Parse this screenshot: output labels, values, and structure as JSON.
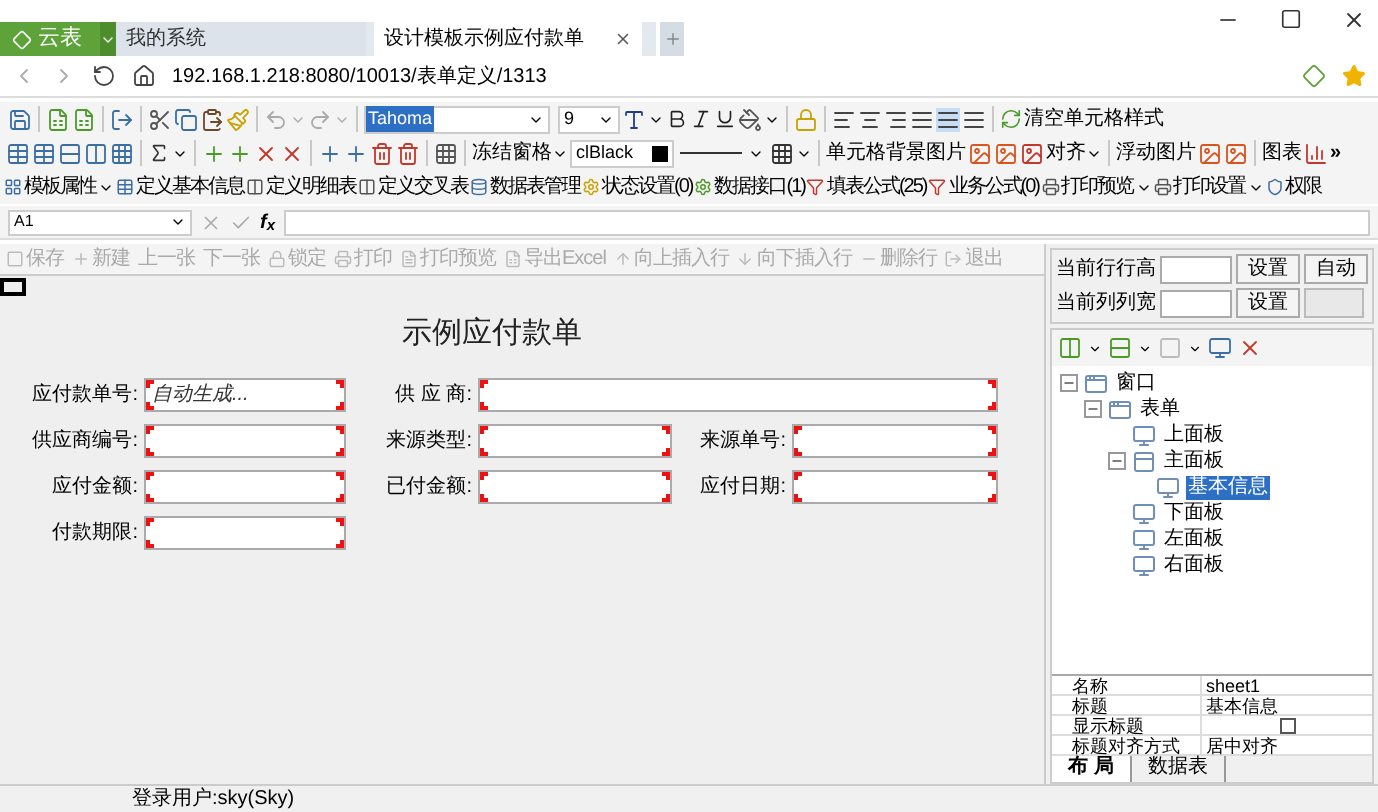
{
  "browser": {
    "brand": "云表",
    "tabs": [
      {
        "label": "我的系统",
        "selected": false
      },
      {
        "label": "设计模板示例应付款单",
        "selected": true
      }
    ],
    "address": "192.168.1.218:8080/10013/表单定义/1313"
  },
  "toolbar_1": {
    "font": "Tahoma",
    "size": "9",
    "clear_style": "清空单元格样式"
  },
  "toolbar_2": {
    "freeze": "冻结窗格",
    "color_name": "clBlack",
    "cell_background": "单元格背景图片",
    "align": "对齐",
    "float_image": "浮动图片",
    "chart": "图表",
    "more": "»"
  },
  "toolbar_3": [
    {
      "label": "模板属性",
      "dropdown": true
    },
    {
      "label": "定义基本信息",
      "dropdown": false
    },
    {
      "label": "定义明细表",
      "dropdown": false
    },
    {
      "label": "定义交叉表",
      "dropdown": false
    },
    {
      "label": "数据表管理",
      "dropdown": false
    },
    {
      "label": "状态设置(0)",
      "dropdown": false
    },
    {
      "label": "数据接口(1)",
      "dropdown": false
    },
    {
      "label": "填表公式(25)",
      "dropdown": false
    },
    {
      "label": "业务公式(0)",
      "dropdown": false
    },
    {
      "label": "打印预览",
      "dropdown": true
    },
    {
      "label": "打印设置",
      "dropdown": true
    },
    {
      "label": "权限",
      "dropdown": false
    }
  ],
  "formula_bar": {
    "cell": "A1",
    "fx": "f$_{x}$"
  },
  "actions": [
    {
      "label": "保存",
      "disabled": true
    },
    {
      "label": "新建",
      "disabled": true
    },
    {
      "label": "上一张",
      "disabled": true
    },
    {
      "label": "下一张",
      "disabled": true
    },
    {
      "label": "锁定",
      "disabled": true
    },
    {
      "label": "打印",
      "disabled": true
    },
    {
      "label": "打印预览",
      "disabled": true
    },
    {
      "label": "导出Excel",
      "disabled": true
    },
    {
      "label": "向上插入行",
      "disabled": true
    },
    {
      "label": "向下插入行",
      "disabled": true
    },
    {
      "label": "删除行",
      "disabled": true
    },
    {
      "label": "退出",
      "disabled": true
    }
  ],
  "form": {
    "title": "示例应付款单",
    "rows": [
      [
        {
          "label": "应付款单号:",
          "placeholder": "自动生成..."
        },
        {
          "label": "供 应 商:"
        }
      ],
      [
        {
          "label": "供应商编号:"
        },
        {
          "label": "来源类型:"
        },
        {
          "label": "来源单号:"
        }
      ],
      [
        {
          "label": "应付金额:"
        },
        {
          "label": "已付金额:"
        },
        {
          "label": "应付日期:"
        }
      ],
      [
        {
          "label": "付款期限:"
        }
      ]
    ]
  },
  "right_panel": {
    "row_height": "当前行行高",
    "col_width": "当前列列宽",
    "set_row": "设置",
    "set_col": "设置",
    "auto": "自动",
    "tree": [
      {
        "label": "窗口",
        "selected": false,
        "children": [
          {
            "label": "表单",
            "selected": false,
            "children": [
              {
                "label": "上面板",
                "selected": false
              },
              {
                "label": "主面板",
                "selected": false,
                "children": [
                  {
                    "label": "基本信息",
                    "selected": true
                  }
                ]
              },
              {
                "label": "下面板",
                "selected": false
              },
              {
                "label": "左面板",
                "selected": false
              },
              {
                "label": "右面板",
                "selected": false
              }
            ]
          }
        ]
      }
    ],
    "properties": [
      {
        "kind": "text",
        "name": "名称",
        "value": "sheet1"
      },
      {
        "kind": "text",
        "name": "标题",
        "value": "基本信息"
      },
      {
        "kind": "checkbox",
        "name": "显示标题",
        "checked": false
      },
      {
        "kind": "text",
        "name": "标题对齐方式",
        "value": "居中对齐"
      }
    ],
    "tabs": [
      {
        "label": "布 局",
        "selected": true
      },
      {
        "label": "数据表",
        "selected": false
      }
    ]
  },
  "status_bar": "登录用户:sky(Sky)"
}
